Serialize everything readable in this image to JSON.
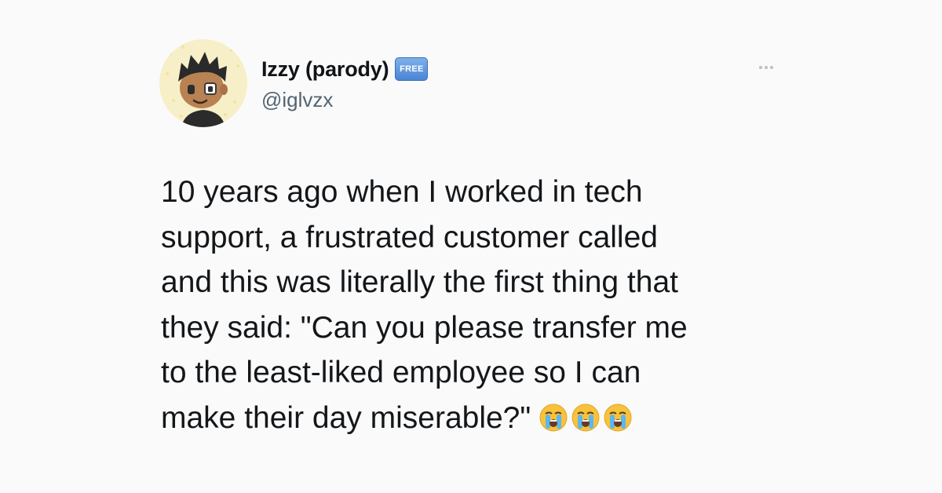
{
  "author": {
    "display_name": "Izzy (parody)",
    "badge": "FREE",
    "handle": "@iglvzx",
    "avatar_icon": "animal-crossing-villager-avatar"
  },
  "more_menu": {
    "icon": "more-options-icon"
  },
  "tweet": {
    "lines": [
      "10 years ago when I worked in tech",
      "support, a frustrated customer called",
      "and this was literally the first thing that",
      "they said: \"Can you please transfer me",
      "to the least-liked employee so I can",
      "make their day miserable?\""
    ],
    "emojis": [
      "loudly-crying-face",
      "loudly-crying-face",
      "loudly-crying-face"
    ]
  },
  "colors": {
    "background": "#fafafa",
    "text": "#14171a",
    "secondary_text": "#536471",
    "badge": "#4a85d4",
    "emoji": "#f7c23c"
  }
}
